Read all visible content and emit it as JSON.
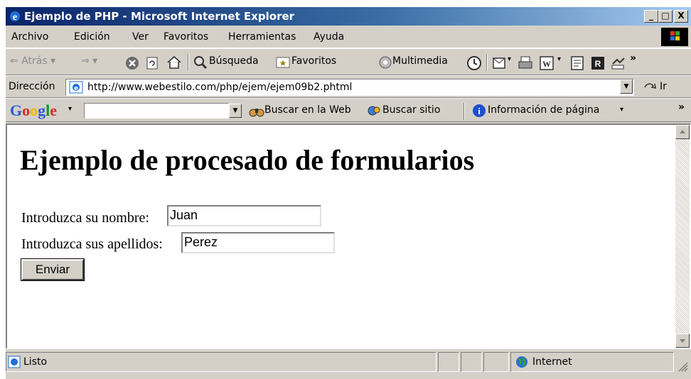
{
  "window": {
    "title": "Ejemplo de PHP - Microsoft Internet Explorer",
    "controls": [
      "_",
      "□",
      "X"
    ]
  },
  "menu": {
    "items": [
      {
        "label": "Archivo"
      },
      {
        "label": "Edición"
      },
      {
        "label": "Ver"
      },
      {
        "label": "Favoritos"
      },
      {
        "label": "Herramientas"
      },
      {
        "label": "Ayuda"
      }
    ]
  },
  "toolbar": {
    "back": "Atrás",
    "search": "Búsqueda",
    "favorites": "Favoritos",
    "multimedia": "Multimedia",
    "more": "»"
  },
  "address": {
    "label": "Dirección",
    "url": "http://www.webestilo.com/php/ejem/ejem09b2.phtml",
    "go": "Ir"
  },
  "google_bar": {
    "logo": "Google",
    "search_web": "Buscar en la Web",
    "search_site": "Buscar sitio",
    "page_info": "Información de página",
    "more": "»"
  },
  "page": {
    "heading": "Ejemplo de procesado de formularios",
    "name_label": "Introduzca su nombre:",
    "name_value": "Juan",
    "surname_label": "Introduzca sus apellidos:",
    "surname_value": "Perez",
    "submit": "Enviar"
  },
  "status": {
    "text": "Listo",
    "zone": "Internet"
  },
  "colors": {
    "title_start": "#0a246a",
    "title_end": "#a6caf0",
    "chrome": "#d4d0c8"
  }
}
